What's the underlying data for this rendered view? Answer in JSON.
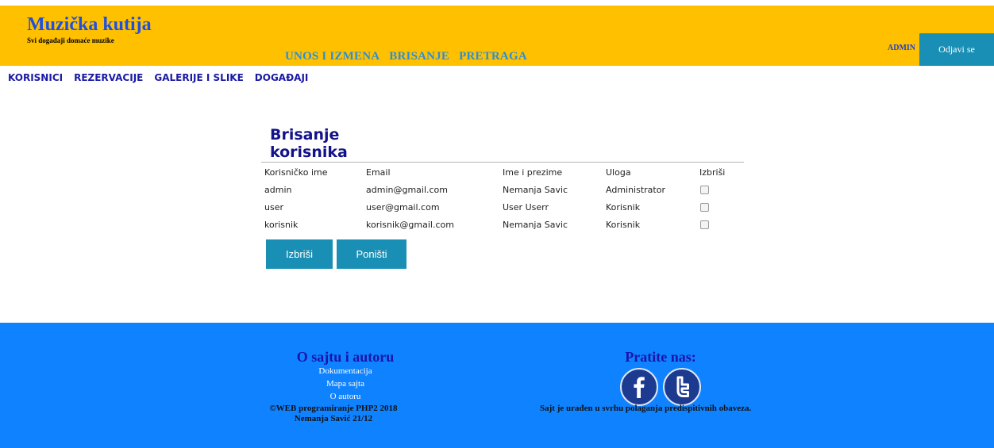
{
  "header": {
    "title": "Muzička kutija",
    "tagline": "Svi događaji domaće muzike",
    "nav": [
      "UNOS I IZMENA",
      "BRISANJE",
      "PRETRAGA"
    ],
    "admin_label": "ADMIN",
    "logout_label": "Odjavi se"
  },
  "admin_nav": [
    "KORISNICI",
    "REZERVACIJE",
    "GALERIJE I SLIKE",
    "DOGAĐAJI"
  ],
  "content": {
    "title": "Brisanje korisnika",
    "columns": [
      "Korisničko ime",
      "Email",
      "Ime i prezime",
      "Uloga",
      "Izbriši"
    ],
    "rows": [
      {
        "username": "admin",
        "email": "admin@gmail.com",
        "name": "Nemanja Savic",
        "role": "Administrator"
      },
      {
        "username": "user",
        "email": "user@gmail.com",
        "name": "User Userr",
        "role": "Korisnik"
      },
      {
        "username": "korisnik",
        "email": "korisnik@gmail.com",
        "name": "Nemanja Savic",
        "role": "Korisnik"
      }
    ],
    "delete_button": "Izbriši",
    "reset_button": "Poništi"
  },
  "footer": {
    "about_heading": "O sajtu i autoru",
    "links": [
      "Dokumentacija",
      "Mapa sajta",
      "O autoru"
    ],
    "follow_heading": "Pratite nas:",
    "social_icons": [
      "facebook-icon",
      "twitter-icon"
    ],
    "copyright_line1": "©WEB programiranje PHP2 2018",
    "copyright_line2": "Nemanja Savić 21/12",
    "note": "Sajt je urađen u svrhu polaganja predispitivnih obaveza."
  },
  "colors": {
    "header_bg": "#ffc000",
    "accent_button": "#1a8fb5",
    "footer_bg": "#0f82ff",
    "title_text": "#12128a"
  }
}
